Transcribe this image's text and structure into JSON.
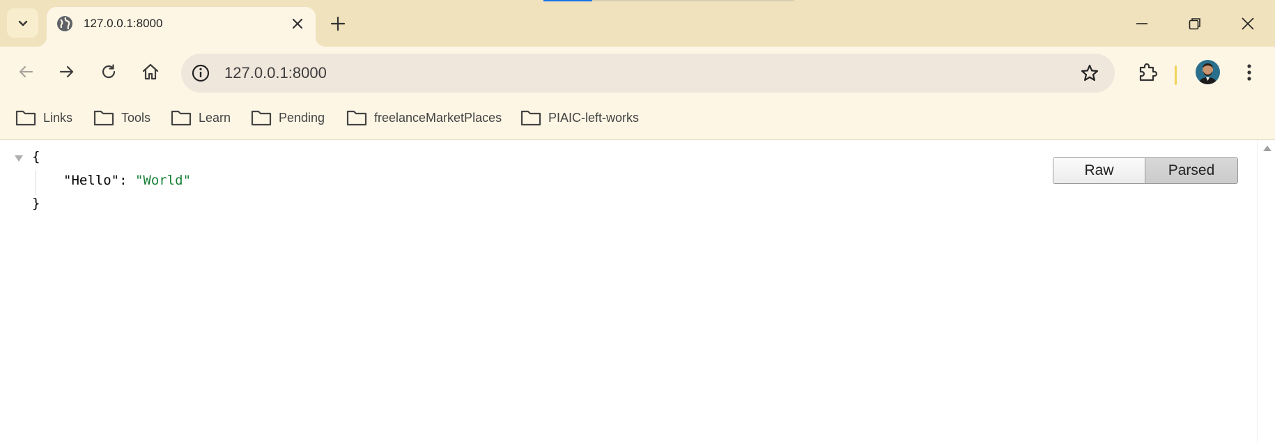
{
  "tab": {
    "title": "127.0.0.1:8000",
    "favicon": "globe-icon",
    "close_icon": "close-icon"
  },
  "window_controls": [
    "minimize-icon",
    "restore-icon",
    "close-icon"
  ],
  "toolbar": {
    "url": "127.0.0.1:8000",
    "site_info_icon": "info-icon",
    "bookmark_icon": "star-icon"
  },
  "bookmarks": [
    {
      "label": "Links"
    },
    {
      "label": "Tools"
    },
    {
      "label": "Learn"
    },
    {
      "label": "Pending"
    },
    {
      "label": "freelanceMarketPlaces"
    },
    {
      "label": "PIAIC-left-works"
    }
  ],
  "json_viewer": {
    "open_brace": "{",
    "close_brace": "}",
    "key": "\"Hello\"",
    "separator": ": ",
    "value": "\"World\"",
    "view_modes": {
      "raw": "Raw",
      "parsed": "Parsed",
      "selected": "Parsed"
    }
  },
  "colors": {
    "tabstrip": "#efe2bc",
    "toolbar": "#fdf6e5",
    "string_value": "#188038",
    "loading_bar": "#1a73e8"
  }
}
